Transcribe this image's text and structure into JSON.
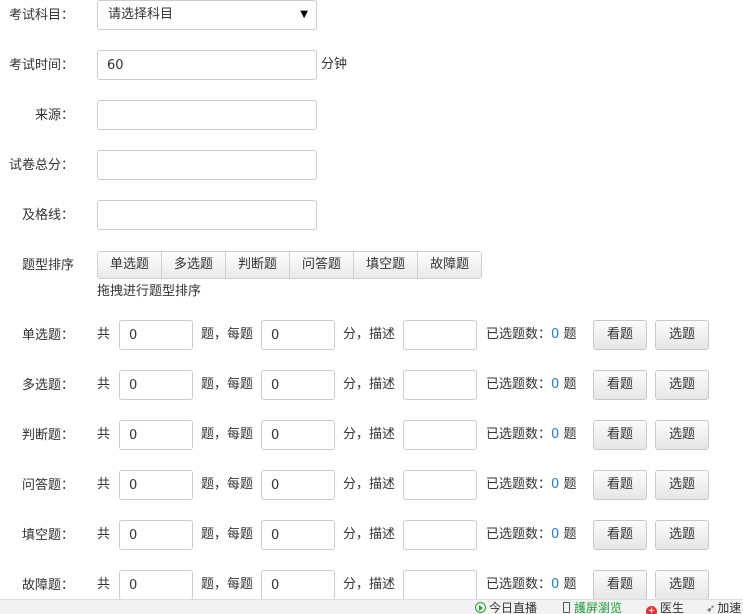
{
  "form": {
    "subject_label": "考试科目：",
    "subject_selected": "请选择科目",
    "duration_label": "考试时间：",
    "duration_value": "60",
    "duration_unit": "分钟",
    "source_label": "来源：",
    "source_value": "",
    "total_label": "试卷总分：",
    "total_value": "",
    "pass_label": "及格线：",
    "pass_value": ""
  },
  "sorting": {
    "label": "题型排序",
    "tabs": [
      "单选题",
      "多选题",
      "判断题",
      "问答题",
      "填空题",
      "故障题"
    ],
    "hint": "拖拽进行题型排序"
  },
  "rows_common": {
    "total_prefix": "共",
    "each_text": "题，每题",
    "desc_text": "分，描述",
    "selected_text": "已选题数：",
    "unit_text": "题",
    "view_button": "看题",
    "pick_button": "选题"
  },
  "rows": [
    {
      "label": "单选题：",
      "count": "0",
      "score": "0",
      "desc": "",
      "selected": "0"
    },
    {
      "label": "多选题：",
      "count": "0",
      "score": "0",
      "desc": "",
      "selected": "0"
    },
    {
      "label": "判断题：",
      "count": "0",
      "score": "0",
      "desc": "",
      "selected": "0"
    },
    {
      "label": "问答题：",
      "count": "0",
      "score": "0",
      "desc": "",
      "selected": "0"
    },
    {
      "label": "填空题：",
      "count": "0",
      "score": "0",
      "desc": "",
      "selected": "0"
    },
    {
      "label": "故障题：",
      "count": "0",
      "score": "0",
      "desc": "",
      "selected": "0"
    }
  ],
  "statusbar": {
    "live": "今日直播",
    "screen": "護屏瀏览",
    "doctor": "医生",
    "speed": "加速"
  },
  "colors": {
    "count_accent": "#2a7fc9",
    "statusbar_green": "#1a9a3a",
    "border": "#cccccc"
  },
  "icons": {
    "select_arrow": "triangle-down-icon",
    "live": "play-circle-icon",
    "screen": "phone-icon",
    "doctor": "doctor-cross-icon",
    "speed": "rocket-icon"
  }
}
